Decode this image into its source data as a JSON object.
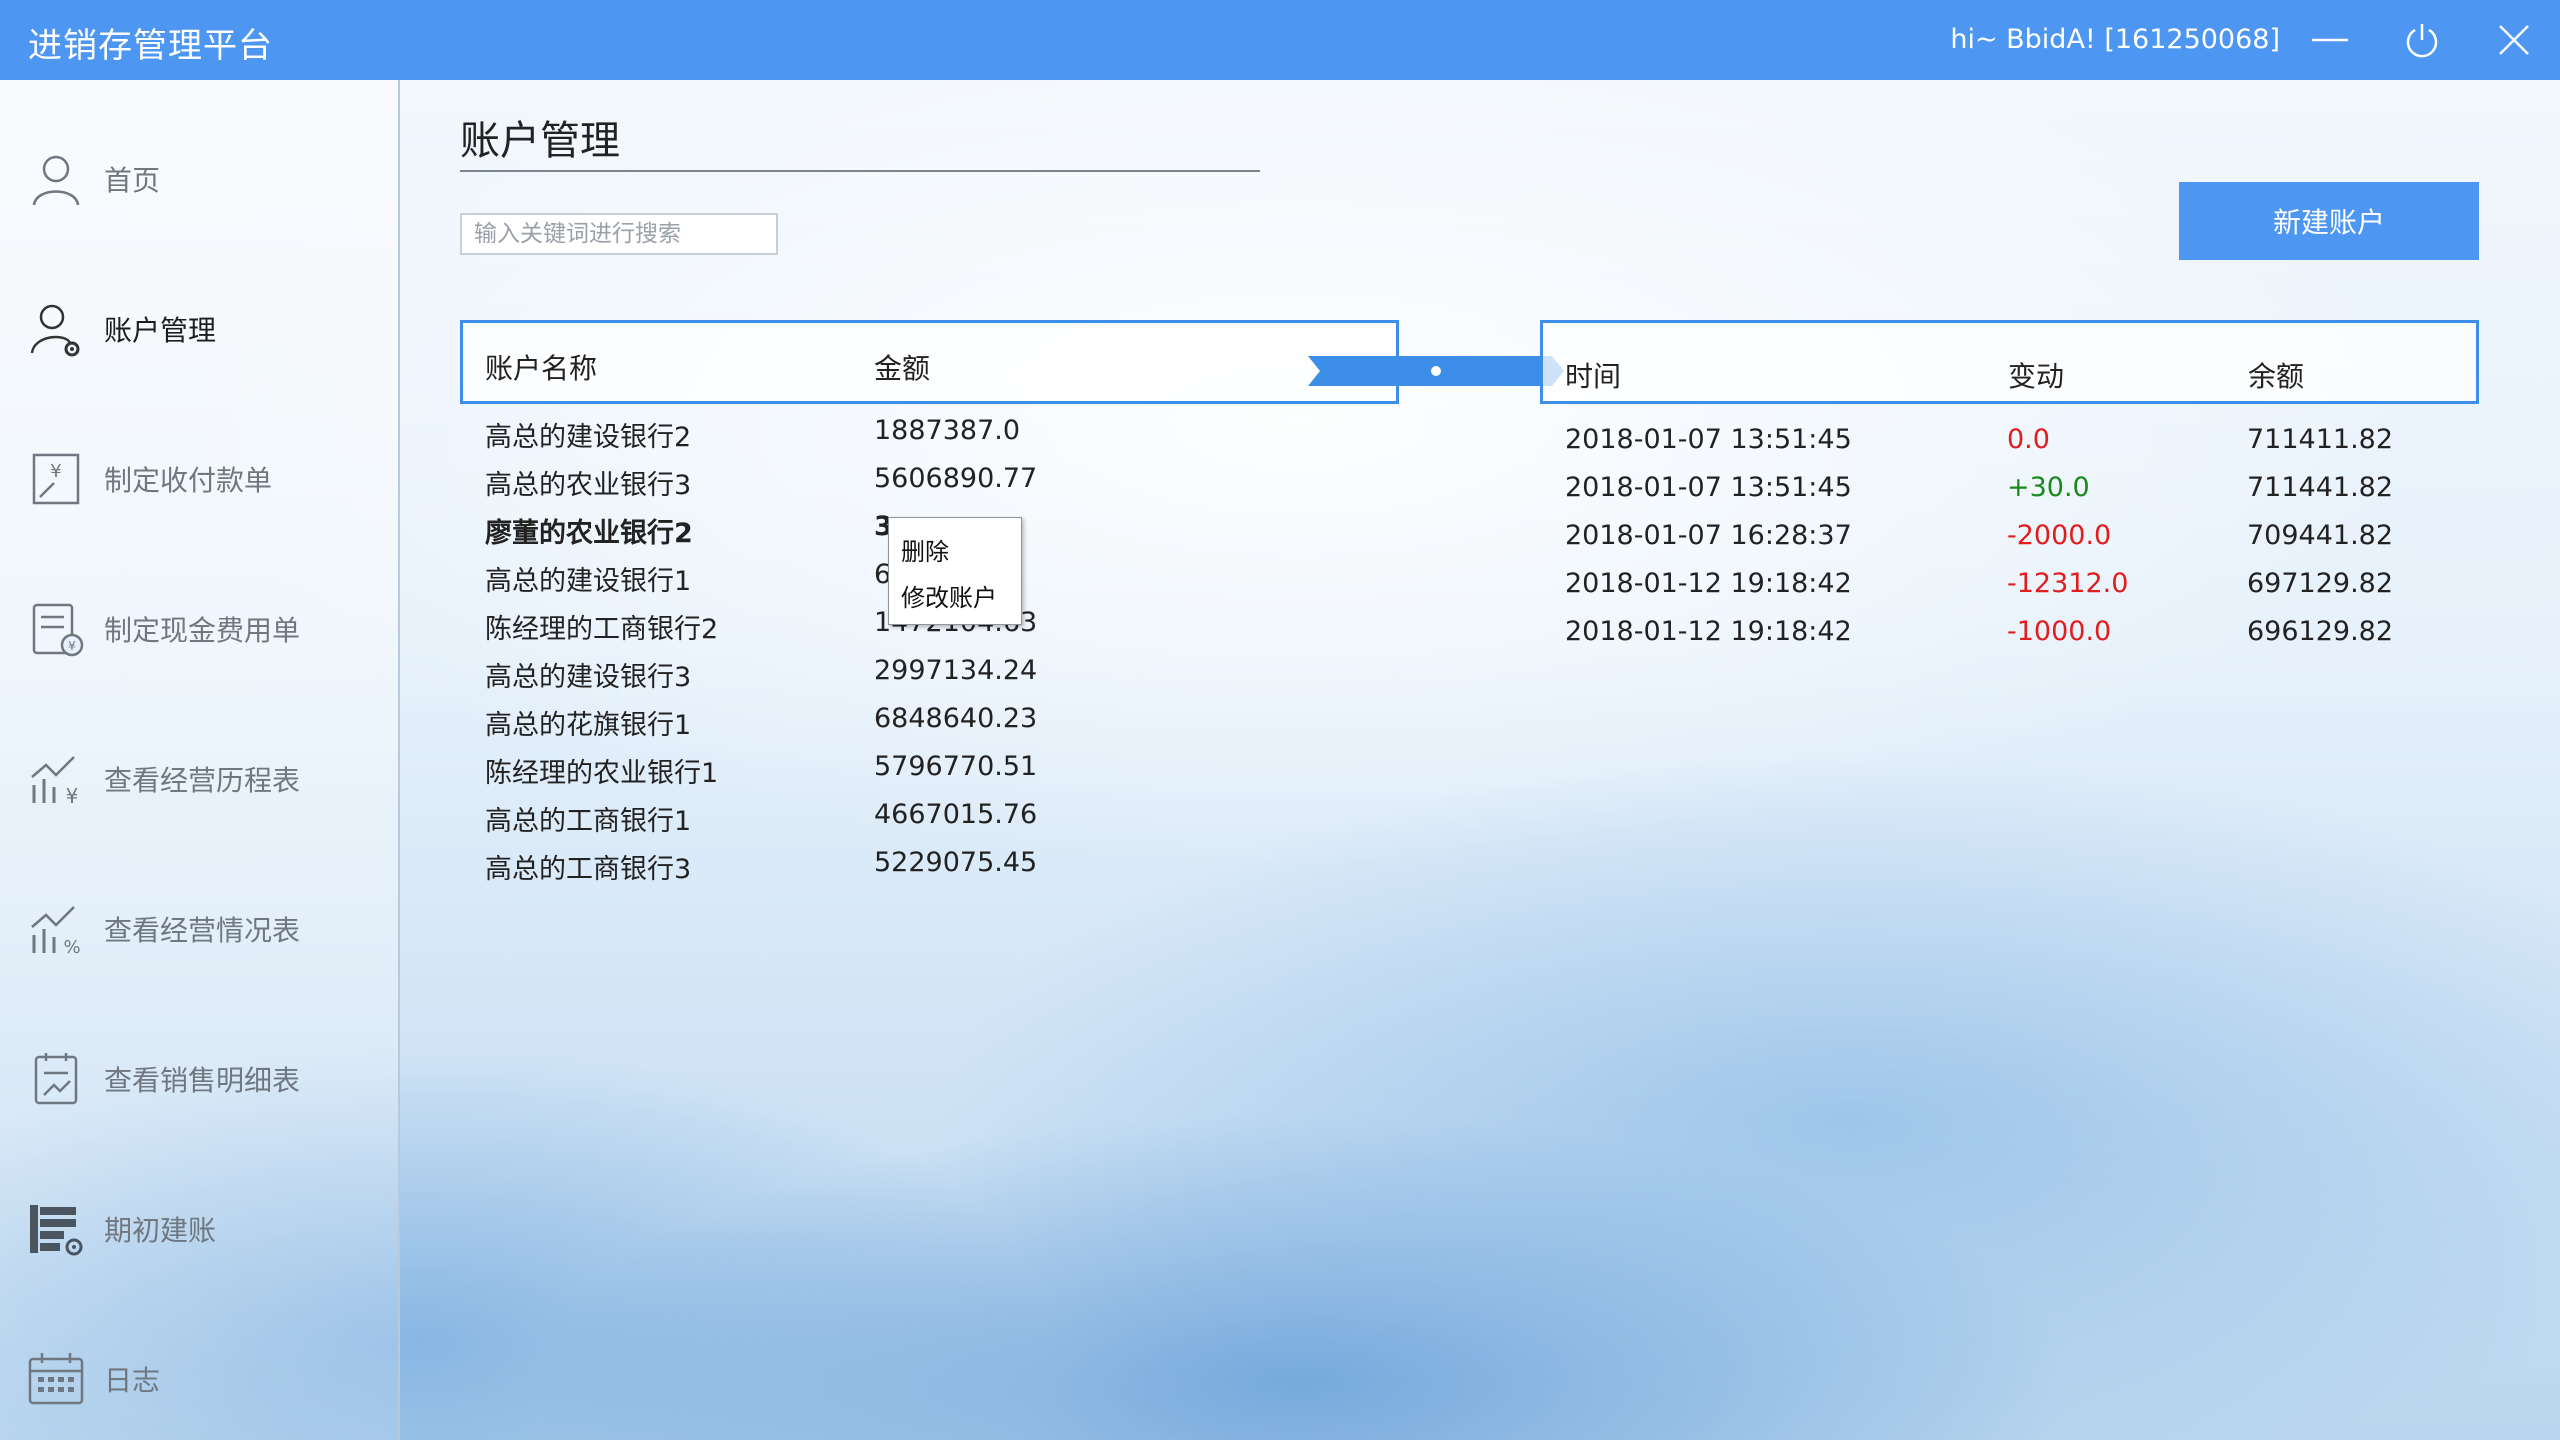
{
  "app": {
    "title": "进销存管理平台",
    "user_info": "hi~ BbidA! [161250068]"
  },
  "colors": {
    "accent": "#4d97f3",
    "header_border": "#3d8ee8",
    "negative": "#e01e1e",
    "positive": "#1a8a1a"
  },
  "sidebar": {
    "items": [
      {
        "label": "首页",
        "icon": "user-icon"
      },
      {
        "label": "账户管理",
        "icon": "user-settings-icon",
        "active": true
      },
      {
        "label": "制定收付款单",
        "icon": "payment-transfer-icon"
      },
      {
        "label": "制定现金费用单",
        "icon": "cash-bill-icon"
      },
      {
        "label": "查看经营历程表",
        "icon": "chart-yen-icon"
      },
      {
        "label": "查看经营情况表",
        "icon": "chart-percent-icon"
      },
      {
        "label": "查看销售明细表",
        "icon": "sales-detail-icon"
      },
      {
        "label": "期初建账",
        "icon": "ledger-settings-icon"
      },
      {
        "label": "日志",
        "icon": "calendar-icon"
      }
    ]
  },
  "page": {
    "title": "账户管理",
    "search_placeholder": "输入关键词进行搜索",
    "new_account_label": "新建账户"
  },
  "accounts": {
    "columns": [
      "账户名称",
      "金额"
    ],
    "rows": [
      {
        "name": "高总的建设银行2",
        "amount": "1887387.0"
      },
      {
        "name": "高总的农业银行3",
        "amount": "5606890.77"
      },
      {
        "name": "廖董的农业银行2",
        "amount": "3",
        "bold": true
      },
      {
        "name": "高总的建设银行1",
        "amount": "6"
      },
      {
        "name": "陈经理的工商银行2",
        "amount": "1472104.63"
      },
      {
        "name": "高总的建设银行3",
        "amount": "2997134.24"
      },
      {
        "name": "高总的花旗银行1",
        "amount": "6848640.23"
      },
      {
        "name": "陈经理的农业银行1",
        "amount": "5796770.51"
      },
      {
        "name": "高总的工商银行1",
        "amount": "4667015.76"
      },
      {
        "name": "高总的工商银行3",
        "amount": "5229075.45"
      }
    ]
  },
  "context_menu": {
    "items": [
      "删除",
      "修改账户"
    ]
  },
  "history": {
    "columns": [
      "时间",
      "变动",
      "余额"
    ],
    "rows": [
      {
        "time": "2018-01-07 13:51:45",
        "change": "0.0",
        "balance": "711411.82",
        "type": "neg"
      },
      {
        "time": "2018-01-07 13:51:45",
        "change": "+30.0",
        "balance": "711441.82",
        "type": "pos"
      },
      {
        "time": "2018-01-07 16:28:37",
        "change": "-2000.0",
        "balance": "709441.82",
        "type": "neg"
      },
      {
        "time": "2018-01-12 19:18:42",
        "change": "-12312.0",
        "balance": "697129.82",
        "type": "neg"
      },
      {
        "time": "2018-01-12 19:18:42",
        "change": "-1000.0",
        "balance": "696129.82",
        "type": "neg"
      }
    ]
  }
}
